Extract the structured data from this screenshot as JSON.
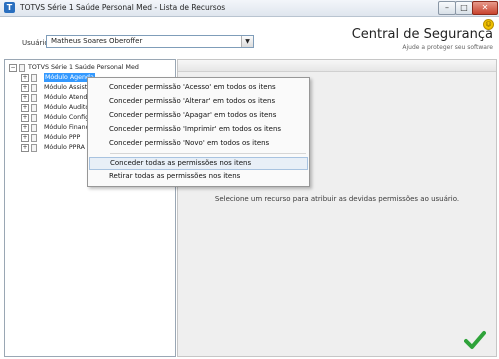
{
  "window": {
    "app_icon": "totvs-app-icon",
    "title": "TOTVS Série 1 Saúde Personal Med - Lista de Recursos",
    "minimize": "–",
    "maximize": "□",
    "close": "✕"
  },
  "header": {
    "user_label": "Usuário:",
    "user_value": "Matheus Soares Oberoffer",
    "brand_title": "Central de Segurança",
    "brand_subtitle": "Ajude a proteger seu software",
    "help_icon": "smiley-icon"
  },
  "tree": {
    "root": "TOTVS Série 1 Saúde Personal Med",
    "items": [
      {
        "label": "Módulo Agenda",
        "selected": true
      },
      {
        "label": "Módulo Assiste",
        "selected": false
      },
      {
        "label": "Módulo Atendi",
        "selected": false
      },
      {
        "label": "Módulo Audito",
        "selected": false
      },
      {
        "label": "Módulo Config",
        "selected": false
      },
      {
        "label": "Módulo Financ",
        "selected": false
      },
      {
        "label": "Módulo PPP",
        "selected": false
      },
      {
        "label": "Módulo PPRA",
        "selected": false
      }
    ]
  },
  "context_menu": {
    "items": [
      "Conceder permissão 'Acesso' em todos os itens",
      "Conceder permissão 'Alterar' em todos os itens",
      "Conceder permissão 'Apagar' em todos os itens",
      "Conceder permissão 'Imprimir' em todos os itens",
      "Conceder permissão 'Novo' em todos os itens",
      "Conceder todas as permissões nos itens",
      "Retirar todas as permissões nos itens"
    ],
    "highlighted_index": 5
  },
  "main": {
    "empty_message": "Selecione um recurso para atribuir as devidas permissões ao usuário.",
    "confirm_icon": "checkmark-icon",
    "accent_color": "#2fa33a"
  }
}
